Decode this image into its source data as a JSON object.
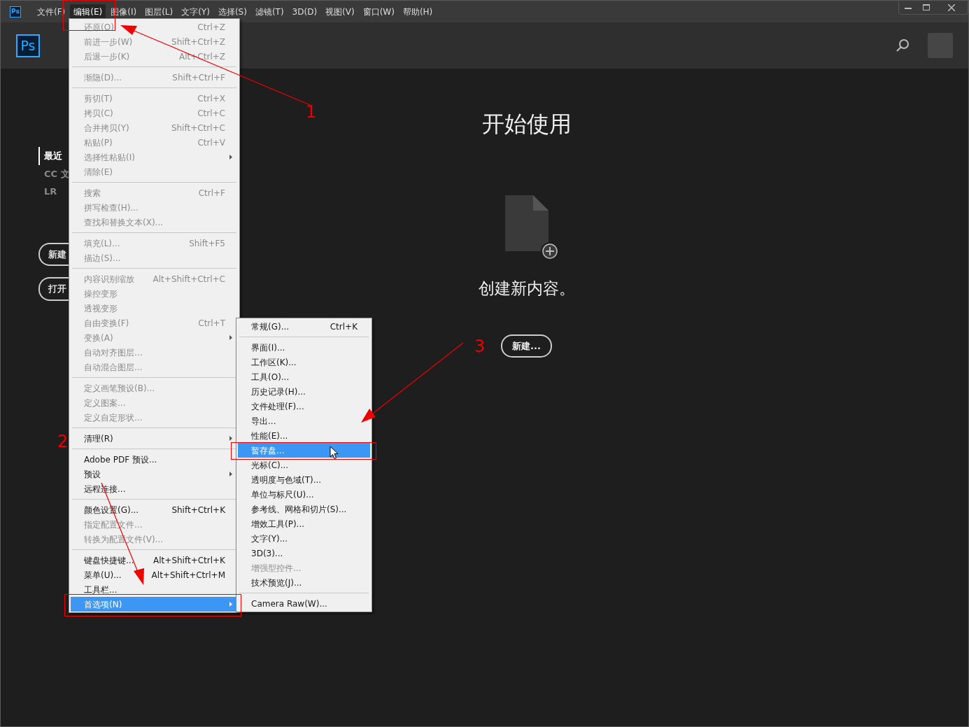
{
  "window": {
    "icon": "Ps"
  },
  "menubar": [
    {
      "label": "文件(F)",
      "selected": false
    },
    {
      "label": "编辑(E)",
      "selected": true
    },
    {
      "label": "图像(I)",
      "selected": false
    },
    {
      "label": "图层(L)",
      "selected": false
    },
    {
      "label": "文字(Y)",
      "selected": false
    },
    {
      "label": "选择(S)",
      "selected": false
    },
    {
      "label": "滤镜(T)",
      "selected": false
    },
    {
      "label": "3D(D)",
      "selected": false
    },
    {
      "label": "视图(V)",
      "selected": false
    },
    {
      "label": "窗口(W)",
      "selected": false
    },
    {
      "label": "帮助(H)",
      "selected": false
    }
  ],
  "header": {
    "logo": "Ps"
  },
  "sidebar": {
    "items": [
      {
        "label": "最近",
        "selected": true
      },
      {
        "label": "CC 文",
        "selected": false
      },
      {
        "label": "LR",
        "selected": false
      }
    ],
    "buttons": [
      "新建",
      "打开"
    ]
  },
  "main": {
    "title": "开始使用",
    "subtitle": "创建新内容。",
    "button": "新建..."
  },
  "edit_menu": {
    "groups": [
      {
        "items": [
          {
            "label": "还原(O)",
            "shortcut": "Ctrl+Z",
            "disabled": true,
            "submenu": false,
            "selected": false
          },
          {
            "label": "前进一步(W)",
            "shortcut": "Shift+Ctrl+Z",
            "disabled": true,
            "submenu": false,
            "selected": false
          },
          {
            "label": "后退一步(K)",
            "shortcut": "Alt+Ctrl+Z",
            "disabled": true,
            "submenu": false,
            "selected": false
          }
        ]
      },
      {
        "items": [
          {
            "label": "渐隐(D)...",
            "shortcut": "Shift+Ctrl+F",
            "disabled": true,
            "submenu": false,
            "selected": false
          }
        ]
      },
      {
        "items": [
          {
            "label": "剪切(T)",
            "shortcut": "Ctrl+X",
            "disabled": true,
            "submenu": false,
            "selected": false
          },
          {
            "label": "拷贝(C)",
            "shortcut": "Ctrl+C",
            "disabled": true,
            "submenu": false,
            "selected": false
          },
          {
            "label": "合并拷贝(Y)",
            "shortcut": "Shift+Ctrl+C",
            "disabled": true,
            "submenu": false,
            "selected": false
          },
          {
            "label": "粘贴(P)",
            "shortcut": "Ctrl+V",
            "disabled": true,
            "submenu": false,
            "selected": false
          },
          {
            "label": "选择性粘贴(I)",
            "disabled": true,
            "submenu": true,
            "selected": false
          },
          {
            "label": "清除(E)",
            "disabled": true,
            "submenu": false,
            "selected": false
          }
        ]
      },
      {
        "items": [
          {
            "label": "搜索",
            "shortcut": "Ctrl+F",
            "disabled": true,
            "submenu": false,
            "selected": false
          },
          {
            "label": "拼写检查(H)...",
            "disabled": true,
            "submenu": false,
            "selected": false
          },
          {
            "label": "查找和替换文本(X)...",
            "disabled": true,
            "submenu": false,
            "selected": false
          }
        ]
      },
      {
        "items": [
          {
            "label": "填充(L)...",
            "shortcut": "Shift+F5",
            "disabled": true,
            "submenu": false,
            "selected": false
          },
          {
            "label": "描边(S)...",
            "disabled": true,
            "submenu": false,
            "selected": false
          }
        ]
      },
      {
        "items": [
          {
            "label": "内容识别缩放",
            "shortcut": "Alt+Shift+Ctrl+C",
            "disabled": true,
            "submenu": false,
            "selected": false
          },
          {
            "label": "操控变形",
            "disabled": true,
            "submenu": false,
            "selected": false
          },
          {
            "label": "透视变形",
            "disabled": true,
            "submenu": false,
            "selected": false
          },
          {
            "label": "自由变换(F)",
            "shortcut": "Ctrl+T",
            "disabled": true,
            "submenu": false,
            "selected": false
          },
          {
            "label": "变换(A)",
            "disabled": true,
            "submenu": true,
            "selected": false
          },
          {
            "label": "自动对齐图层...",
            "disabled": true,
            "submenu": false,
            "selected": false
          },
          {
            "label": "自动混合图层...",
            "disabled": true,
            "submenu": false,
            "selected": false
          }
        ]
      },
      {
        "items": [
          {
            "label": "定义画笔预设(B)...",
            "disabled": true,
            "submenu": false,
            "selected": false
          },
          {
            "label": "定义图案...",
            "disabled": true,
            "submenu": false,
            "selected": false
          },
          {
            "label": "定义自定形状...",
            "disabled": true,
            "submenu": false,
            "selected": false
          }
        ]
      },
      {
        "items": [
          {
            "label": "清理(R)",
            "disabled": false,
            "submenu": true,
            "selected": false
          }
        ]
      },
      {
        "items": [
          {
            "label": "Adobe PDF 预设...",
            "disabled": false,
            "submenu": false,
            "selected": false
          },
          {
            "label": "预设",
            "disabled": false,
            "submenu": true,
            "selected": false
          },
          {
            "label": "远程连接...",
            "disabled": false,
            "submenu": false,
            "selected": false
          }
        ]
      },
      {
        "items": [
          {
            "label": "颜色设置(G)...",
            "shortcut": "Shift+Ctrl+K",
            "disabled": false,
            "submenu": false,
            "selected": false
          },
          {
            "label": "指定配置文件...",
            "disabled": true,
            "submenu": false,
            "selected": false
          },
          {
            "label": "转换为配置文件(V)...",
            "disabled": true,
            "submenu": false,
            "selected": false
          }
        ]
      },
      {
        "items": [
          {
            "label": "键盘快捷键...",
            "shortcut": "Alt+Shift+Ctrl+K",
            "disabled": false,
            "submenu": false,
            "selected": false
          },
          {
            "label": "菜单(U)...",
            "shortcut": "Alt+Shift+Ctrl+M",
            "disabled": false,
            "submenu": false,
            "selected": false
          },
          {
            "label": "工具栏...",
            "disabled": false,
            "submenu": false,
            "selected": false
          },
          {
            "label": "首选项(N)",
            "disabled": false,
            "submenu": true,
            "selected": true
          }
        ]
      }
    ]
  },
  "preferences_menu": {
    "groups": [
      {
        "items": [
          {
            "label": "常规(G)...",
            "shortcut": "Ctrl+K",
            "disabled": false,
            "submenu": false,
            "selected": false
          }
        ]
      },
      {
        "items": [
          {
            "label": "界面(I)...",
            "disabled": false,
            "submenu": false,
            "selected": false
          },
          {
            "label": "工作区(K)...",
            "disabled": false,
            "submenu": false,
            "selected": false
          },
          {
            "label": "工具(O)...",
            "disabled": false,
            "submenu": false,
            "selected": false
          },
          {
            "label": "历史记录(H)...",
            "disabled": false,
            "submenu": false,
            "selected": false
          },
          {
            "label": "文件处理(F)...",
            "disabled": false,
            "submenu": false,
            "selected": false
          },
          {
            "label": "导出...",
            "disabled": false,
            "submenu": false,
            "selected": false
          },
          {
            "label": "性能(E)...",
            "disabled": false,
            "submenu": false,
            "selected": false
          },
          {
            "label": "暂存盘...",
            "disabled": false,
            "submenu": false,
            "selected": true
          },
          {
            "label": "光标(C)...",
            "disabled": false,
            "submenu": false,
            "selected": false
          },
          {
            "label": "透明度与色域(T)...",
            "disabled": false,
            "submenu": false,
            "selected": false
          },
          {
            "label": "单位与标尺(U)...",
            "disabled": false,
            "submenu": false,
            "selected": false
          },
          {
            "label": "参考线、网格和切片(S)...",
            "disabled": false,
            "submenu": false,
            "selected": false
          },
          {
            "label": "增效工具(P)...",
            "disabled": false,
            "submenu": false,
            "selected": false
          },
          {
            "label": "文字(Y)...",
            "disabled": false,
            "submenu": false,
            "selected": false
          },
          {
            "label": "3D(3)...",
            "disabled": false,
            "submenu": false,
            "selected": false
          },
          {
            "label": "增强型控件...",
            "disabled": true,
            "submenu": false,
            "selected": false
          },
          {
            "label": "技术预览(J)...",
            "disabled": false,
            "submenu": false,
            "selected": false
          }
        ]
      },
      {
        "items": [
          {
            "label": "Camera Raw(W)...",
            "disabled": false,
            "submenu": false,
            "selected": false
          }
        ]
      }
    ]
  },
  "annotations": [
    "1",
    "2",
    "3"
  ]
}
